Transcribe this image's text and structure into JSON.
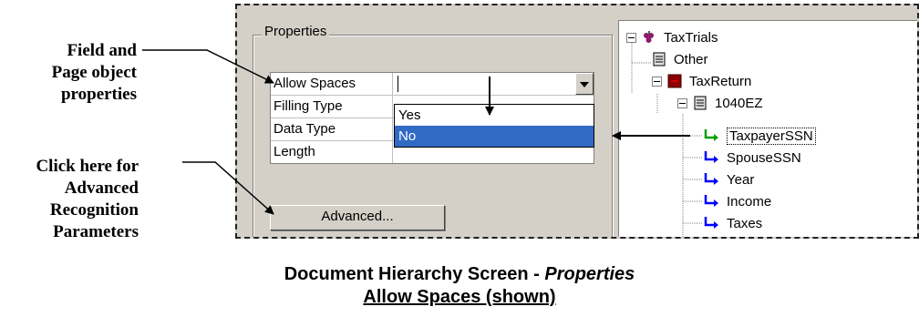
{
  "annotations": {
    "field_page": [
      "Field and",
      "Page object",
      "properties"
    ],
    "advanced": [
      "Click here for",
      "Advanced",
      "Recognition",
      "Parameters"
    ]
  },
  "properties": {
    "group_label": "Properties",
    "rows": [
      {
        "name": "Allow Spaces",
        "value": ""
      },
      {
        "name": "Filling Type",
        "value": ""
      },
      {
        "name": "Data Type",
        "value": ""
      },
      {
        "name": "Length",
        "value": ""
      }
    ],
    "dropdown_options": [
      "Yes",
      "No"
    ],
    "dropdown_selected": "No",
    "advanced_button": "Advanced..."
  },
  "tree": {
    "nodes": [
      "TaxTrials",
      "Other",
      "TaxReturn",
      "1040EZ",
      "TaxpayerSSN",
      "SpouseSSN",
      "Year",
      "Income",
      "Taxes"
    ],
    "selected": "TaxpayerSSN"
  },
  "caption": {
    "line1_prefix": "Document Hierarchy Screen - ",
    "line1_italic": "Properties",
    "line2": "Allow Spaces (shown)"
  },
  "colors": {
    "selection": "#316ac5",
    "field_arrow_green": "#00a000",
    "field_arrow_blue": "#0000ff",
    "dialog_bg": "#d4d0c8"
  }
}
